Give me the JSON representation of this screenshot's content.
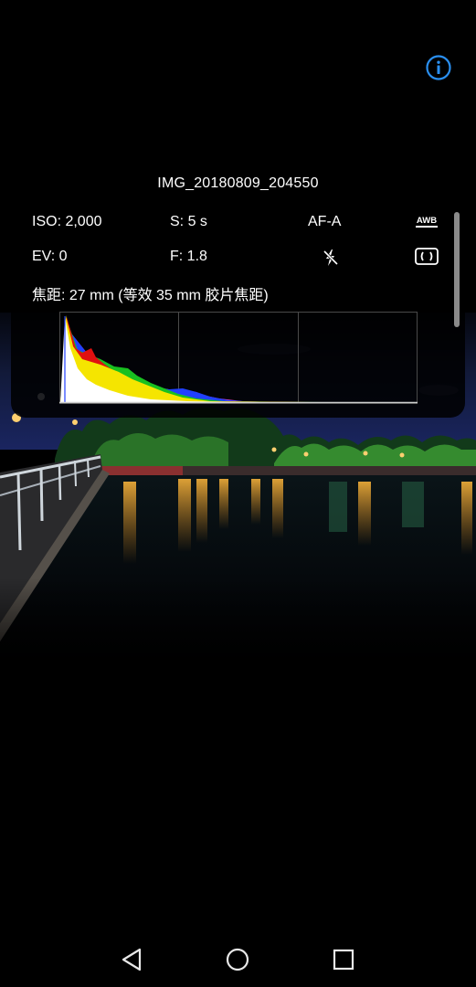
{
  "header": {
    "info_icon": "info-circle-icon",
    "info_color": "#2a8ff0"
  },
  "photo": {
    "icon": "night-waterfront-photo"
  },
  "details": {
    "filename": "IMG_20180809_204550",
    "iso": "ISO: 2,000",
    "shutter": "S: 5 s",
    "focus_mode": "AF-A",
    "white_balance_icon": "awb-icon",
    "white_balance_label": "AWB",
    "ev": "EV: 0",
    "aperture": "F: 1.8",
    "flash_icon": "flash-off-icon",
    "metering_icon": "metering-mode-icon",
    "focal_length": "焦距: 27 mm (等效 35 mm 胶片焦距)"
  },
  "histogram": {
    "icon": "histogram",
    "colors": {
      "white": "#ffffff",
      "yellow": "#f5e500",
      "red": "#e01010",
      "green": "#18c020",
      "blue": "#2040ff",
      "magenta": "#d040d0"
    }
  },
  "navbar": {
    "back_icon": "triangle-back-icon",
    "home_icon": "circle-home-icon",
    "recent_icon": "square-recents-icon"
  }
}
